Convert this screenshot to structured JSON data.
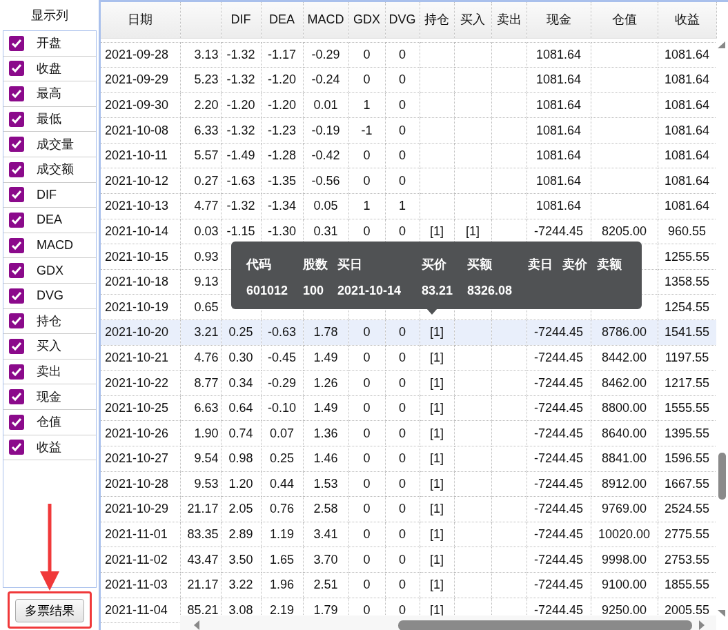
{
  "sidebar": {
    "title": "显示列",
    "items": [
      {
        "label": "开盘",
        "checked": true
      },
      {
        "label": "收盘",
        "checked": true
      },
      {
        "label": "最高",
        "checked": true
      },
      {
        "label": "最低",
        "checked": true
      },
      {
        "label": "成交量",
        "checked": true
      },
      {
        "label": "成交额",
        "checked": true
      },
      {
        "label": "DIF",
        "checked": true
      },
      {
        "label": "DEA",
        "checked": true
      },
      {
        "label": "MACD",
        "checked": true
      },
      {
        "label": "GDX",
        "checked": true
      },
      {
        "label": "DVG",
        "checked": true
      },
      {
        "label": "持仓",
        "checked": true
      },
      {
        "label": "买入",
        "checked": true
      },
      {
        "label": "卖出",
        "checked": true
      },
      {
        "label": "现金",
        "checked": true
      },
      {
        "label": "仓值",
        "checked": true
      },
      {
        "label": "收益",
        "checked": true
      }
    ],
    "button": "多票结果"
  },
  "table": {
    "columns": [
      "日期",
      null,
      "DIF",
      "DEA",
      "MACD",
      "GDX",
      "DVG",
      "持仓",
      "买入",
      "卖出",
      "现金",
      "仓值",
      "收益"
    ],
    "rows": [
      {
        "selected": false,
        "cells": [
          "2021-09-28",
          "3.13",
          "-1.32",
          "-1.17",
          "-0.29",
          "0",
          "0",
          null,
          null,
          null,
          "1081.64",
          null,
          "1081.64"
        ]
      },
      {
        "selected": false,
        "cells": [
          "2021-09-29",
          "5.23",
          "-1.32",
          "-1.20",
          "-0.24",
          "0",
          "0",
          null,
          null,
          null,
          "1081.64",
          null,
          "1081.64"
        ]
      },
      {
        "selected": false,
        "cells": [
          "2021-09-30",
          "2.20",
          "-1.20",
          "-1.20",
          "0.01",
          "1",
          "0",
          null,
          null,
          null,
          "1081.64",
          null,
          "1081.64"
        ]
      },
      {
        "selected": false,
        "cells": [
          "2021-10-08",
          "6.33",
          "-1.32",
          "-1.23",
          "-0.19",
          "-1",
          "0",
          null,
          null,
          null,
          "1081.64",
          null,
          "1081.64"
        ]
      },
      {
        "selected": false,
        "cells": [
          "2021-10-11",
          "5.57",
          "-1.49",
          "-1.28",
          "-0.42",
          "0",
          "0",
          null,
          null,
          null,
          "1081.64",
          null,
          "1081.64"
        ]
      },
      {
        "selected": false,
        "cells": [
          "2021-10-12",
          "0.27",
          "-1.63",
          "-1.35",
          "-0.56",
          "0",
          "0",
          null,
          null,
          null,
          "1081.64",
          null,
          "1081.64"
        ]
      },
      {
        "selected": false,
        "cells": [
          "2021-10-13",
          "4.77",
          "-1.32",
          "-1.34",
          "0.05",
          "1",
          "1",
          null,
          null,
          null,
          "1081.64",
          null,
          "1081.64"
        ]
      },
      {
        "selected": false,
        "cells": [
          "2021-10-14",
          "0.03",
          "-1.15",
          "-1.30",
          "0.31",
          "0",
          "0",
          "[1]",
          "[1]",
          null,
          "-7244.45",
          "8205.00",
          "960.55"
        ]
      },
      {
        "selected": false,
        "cells": [
          "2021-10-15",
          "0.93",
          null,
          null,
          null,
          null,
          null,
          null,
          null,
          null,
          null,
          null,
          "1255.55"
        ]
      },
      {
        "selected": false,
        "cells": [
          "2021-10-18",
          "9.13",
          null,
          null,
          null,
          null,
          null,
          null,
          null,
          null,
          null,
          null,
          "1358.55"
        ]
      },
      {
        "selected": false,
        "cells": [
          "2021-10-19",
          "0.65",
          null,
          null,
          null,
          null,
          null,
          null,
          null,
          null,
          null,
          null,
          "1254.55"
        ]
      },
      {
        "selected": true,
        "cells": [
          "2021-10-20",
          "3.21",
          "0.25",
          "-0.63",
          "1.78",
          "0",
          "0",
          "[1]",
          null,
          null,
          "-7244.45",
          "8786.00",
          "1541.55"
        ]
      },
      {
        "selected": false,
        "cells": [
          "2021-10-21",
          "4.76",
          "0.30",
          "-0.45",
          "1.49",
          "0",
          "0",
          "[1]",
          null,
          null,
          "-7244.45",
          "8442.00",
          "1197.55"
        ]
      },
      {
        "selected": false,
        "cells": [
          "2021-10-22",
          "8.77",
          "0.34",
          "-0.29",
          "1.26",
          "0",
          "0",
          "[1]",
          null,
          null,
          "-7244.45",
          "8462.00",
          "1217.55"
        ]
      },
      {
        "selected": false,
        "cells": [
          "2021-10-25",
          "6.63",
          "0.64",
          "-0.10",
          "1.49",
          "0",
          "0",
          "[1]",
          null,
          null,
          "-7244.45",
          "8800.00",
          "1555.55"
        ]
      },
      {
        "selected": false,
        "cells": [
          "2021-10-26",
          "1.90",
          "0.74",
          "0.07",
          "1.36",
          "0",
          "0",
          "[1]",
          null,
          null,
          "-7244.45",
          "8640.00",
          "1395.55"
        ]
      },
      {
        "selected": false,
        "cells": [
          "2021-10-27",
          "9.54",
          "0.98",
          "0.25",
          "1.46",
          "0",
          "0",
          "[1]",
          null,
          null,
          "-7244.45",
          "8841.00",
          "1596.55"
        ]
      },
      {
        "selected": false,
        "cells": [
          "2021-10-28",
          "9.53",
          "1.20",
          "0.44",
          "1.53",
          "0",
          "0",
          "[1]",
          null,
          null,
          "-7244.45",
          "8912.00",
          "1667.55"
        ]
      },
      {
        "selected": false,
        "cells": [
          "2021-10-29",
          "21.17",
          "2.05",
          "0.76",
          "2.58",
          "0",
          "0",
          "[1]",
          null,
          null,
          "-7244.45",
          "9769.00",
          "2524.55"
        ]
      },
      {
        "selected": false,
        "cells": [
          "2021-11-01",
          "83.35",
          "2.89",
          "1.19",
          "3.41",
          "0",
          "0",
          "[1]",
          null,
          null,
          "-7244.45",
          "10020.00",
          "2775.55"
        ]
      },
      {
        "selected": false,
        "cells": [
          "2021-11-02",
          "43.47",
          "3.50",
          "1.65",
          "3.70",
          "0",
          "0",
          "[1]",
          null,
          null,
          "-7244.45",
          "9998.00",
          "2753.55"
        ]
      },
      {
        "selected": false,
        "cells": [
          "2021-11-03",
          "21.17",
          "3.22",
          "1.96",
          "2.51",
          "0",
          "0",
          "[1]",
          null,
          null,
          "-7244.45",
          "9100.00",
          "1855.55"
        ]
      },
      {
        "selected": false,
        "cells": [
          "2021-11-04",
          "85.21",
          "3.08",
          "2.19",
          "1.79",
          "0",
          "0",
          "[1]",
          null,
          null,
          "-7244.45",
          "9250.00",
          "2005.55"
        ]
      }
    ]
  },
  "tooltip": {
    "columns": [
      "代码",
      "股数",
      "买日",
      "买价",
      "买额",
      "卖日",
      "卖价",
      "卖额"
    ],
    "values": [
      "601012",
      "100",
      "2021-10-14",
      "83.21",
      "8326.08"
    ]
  }
}
